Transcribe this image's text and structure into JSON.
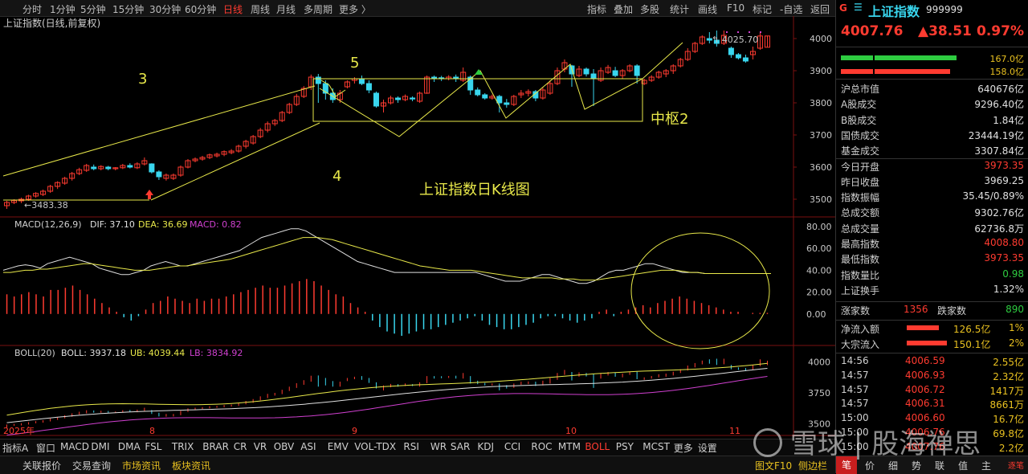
{
  "toolbar": {
    "periods": [
      "分时",
      "1分钟",
      "5分钟",
      "15分钟",
      "30分钟",
      "60分钟",
      "日线",
      "周线",
      "月线",
      "多周期",
      "更多 〉"
    ],
    "active_period": "日线",
    "right_tools": [
      "指标",
      "叠加",
      "多股",
      "统计",
      "画线",
      "F10",
      "标记",
      "-自选",
      "返回"
    ]
  },
  "chart": {
    "title": "上证指数(日线,前复权)",
    "price_ticks": [
      "4000",
      "3900",
      "3800",
      "3700",
      "3600",
      "3500"
    ],
    "high_label": "4025.70",
    "low_label": "3483.38",
    "annotations": {
      "wave3": "3",
      "wave4": "4",
      "wave5": "5",
      "zhongshu": "中枢2",
      "chart_title": "上证指数日K线图"
    },
    "month_labels": [
      "2025年",
      "8",
      "9",
      "10",
      "11"
    ]
  },
  "macd": {
    "label": "MACD(12,26,9)",
    "dif_label": "DIF: 37.10",
    "dea_label": "DEA: 36.69",
    "macd_label": "MACD: 0.82",
    "ticks": [
      "80.00",
      "60.00",
      "40.00",
      "20.00",
      "0.00"
    ]
  },
  "boll": {
    "label": "BOLL(20)",
    "boll_label": "BOLL: 3937.18",
    "ub_label": "UB: 4039.44",
    "lb_label": "LB: 3834.92",
    "ticks": [
      "4000",
      "3750",
      "3500"
    ]
  },
  "indicator_tabs": [
    "指标A",
    "窗口",
    "MACD",
    "DMI",
    "DMA",
    "FSL",
    "TRIX",
    "BRAR",
    "CR",
    "VR",
    "OBV",
    "ASI",
    "EMV",
    "VOL-TDX",
    "RSI",
    "WR",
    "SAR",
    "KDJ",
    "CCI",
    "ROC",
    "MTM",
    "BOLL",
    "PSY",
    "MCST",
    "更多",
    "设置"
  ],
  "active_indicator": "BOLL",
  "status_tabs": [
    "关联报价",
    "交易查询",
    "市场资讯",
    "板块资讯"
  ],
  "status_right": [
    "图文F10",
    "侧边栏"
  ],
  "watermark": "雪球 | 股海禅思",
  "quote": {
    "flag": "G",
    "name": "上证指数",
    "code": "999999",
    "price": "4007.76",
    "change": "▲38.51",
    "pct": "0.97%",
    "bar1": "167.0亿",
    "bar2": "158.0亿",
    "stats": [
      {
        "label": "沪总市值",
        "value": "640676亿",
        "color": "white"
      },
      {
        "label": "A股成交",
        "value": "9296.40亿",
        "color": "white"
      },
      {
        "label": "B股成交",
        "value": "1.84亿",
        "color": "white"
      },
      {
        "label": "国债成交",
        "value": "23444.19亿",
        "color": "white"
      },
      {
        "label": "基金成交",
        "value": "3307.84亿",
        "color": "white"
      },
      {
        "label": "今日开盘",
        "value": "3973.35",
        "color": "red"
      },
      {
        "label": "昨日收盘",
        "value": "3969.25",
        "color": "white"
      },
      {
        "label": "指数振幅",
        "value": "35.45/0.89%",
        "color": "white"
      },
      {
        "label": "总成交额",
        "value": "9302.76亿",
        "color": "white"
      },
      {
        "label": "总成交量",
        "value": "62736.8万",
        "color": "white"
      },
      {
        "label": "最高指数",
        "value": "4008.80",
        "color": "red"
      },
      {
        "label": "最低指数",
        "value": "3973.35",
        "color": "red"
      },
      {
        "label": "指数量比",
        "value": "0.98",
        "color": "green"
      },
      {
        "label": "上证换手",
        "value": "1.32%",
        "color": "white"
      }
    ],
    "up_label": "涨家数",
    "up_value": "1356",
    "down_label": "跌家数",
    "down_value": "890",
    "flow1_label": "净流入额",
    "flow1_value": "126.5亿",
    "flow1_pct": "1%",
    "flow2_label": "大宗流入",
    "flow2_value": "150.1亿",
    "flow2_pct": "2%",
    "ticks": [
      {
        "time": "14:56",
        "price": "4006.59",
        "vol": "2.55亿"
      },
      {
        "time": "14:57",
        "price": "4006.93",
        "vol": "2.32亿"
      },
      {
        "time": "14:57",
        "price": "4006.72",
        "vol": "1417万"
      },
      {
        "time": "14:57",
        "price": "4006.31",
        "vol": "8661万"
      },
      {
        "time": "15:00",
        "price": "4006.60",
        "vol": "16.7亿"
      },
      {
        "time": "15:00",
        "price": "4006.76",
        "vol": "69.8亿"
      },
      {
        "time": "15:00",
        "price": "4007.76",
        "vol": "2.2亿"
      }
    ],
    "bottom_tabs": [
      "笔",
      "价",
      "细",
      "势",
      "联",
      "值",
      "主"
    ],
    "bottom_extra": "逐笔"
  },
  "chart_data": {
    "type": "candlestick",
    "title": "上证指数日K线图",
    "ylim": [
      3450,
      4050
    ],
    "candles": [
      [
        3480,
        3490,
        3470,
        3495
      ],
      [
        3490,
        3496,
        3485,
        3500
      ],
      [
        3495,
        3500,
        3488,
        3505
      ],
      [
        3500,
        3510,
        3495,
        3514
      ],
      [
        3510,
        3518,
        3505,
        3522
      ],
      [
        3515,
        3525,
        3510,
        3530
      ],
      [
        3525,
        3540,
        3520,
        3545
      ],
      [
        3540,
        3552,
        3532,
        3556
      ],
      [
        3550,
        3565,
        3545,
        3570
      ],
      [
        3565,
        3580,
        3558,
        3585
      ],
      [
        3580,
        3592,
        3575,
        3598
      ],
      [
        3590,
        3605,
        3585,
        3610
      ],
      [
        3600,
        3595,
        3590,
        3608
      ],
      [
        3595,
        3602,
        3590,
        3606
      ],
      [
        3600,
        3595,
        3590,
        3604
      ],
      [
        3595,
        3598,
        3590,
        3600
      ],
      [
        3598,
        3605,
        3594,
        3610
      ],
      [
        3605,
        3600,
        3596,
        3612
      ],
      [
        3598,
        3610,
        3594,
        3615
      ],
      [
        3610,
        3620,
        3605,
        3630
      ],
      [
        3610,
        3585,
        3580,
        3612
      ],
      [
        3585,
        3570,
        3560,
        3590
      ],
      [
        3565,
        3575,
        3558,
        3580
      ],
      [
        3565,
        3575,
        3560,
        3580
      ],
      [
        3575,
        3600,
        3570,
        3605
      ],
      [
        3600,
        3620,
        3596,
        3625
      ],
      [
        3620,
        3625,
        3615,
        3630
      ],
      [
        3625,
        3630,
        3620,
        3635
      ],
      [
        3630,
        3638,
        3625,
        3642
      ],
      [
        3635,
        3640,
        3630,
        3645
      ],
      [
        3640,
        3648,
        3634,
        3652
      ],
      [
        3645,
        3650,
        3640,
        3656
      ],
      [
        3650,
        3665,
        3645,
        3670
      ],
      [
        3665,
        3680,
        3658,
        3685
      ],
      [
        3675,
        3695,
        3670,
        3700
      ],
      [
        3695,
        3715,
        3690,
        3722
      ],
      [
        3715,
        3735,
        3708,
        3742
      ],
      [
        3735,
        3745,
        3728,
        3750
      ],
      [
        3745,
        3770,
        3740,
        3775
      ],
      [
        3770,
        3795,
        3765,
        3800
      ],
      [
        3795,
        3820,
        3790,
        3828
      ],
      [
        3820,
        3845,
        3815,
        3852
      ],
      [
        3850,
        3880,
        3840,
        3888
      ],
      [
        3880,
        3860,
        3800,
        3890
      ],
      [
        3860,
        3830,
        3810,
        3870
      ],
      [
        3830,
        3810,
        3800,
        3845
      ],
      [
        3810,
        3830,
        3800,
        3840
      ],
      [
        3850,
        3865,
        3845,
        3870
      ],
      [
        3870,
        3875,
        3860,
        3880
      ],
      [
        3875,
        3860,
        3855,
        3885
      ],
      [
        3860,
        3840,
        3830,
        3870
      ],
      [
        3830,
        3790,
        3785,
        3835
      ],
      [
        3790,
        3800,
        3770,
        3810
      ],
      [
        3800,
        3815,
        3795,
        3822
      ],
      [
        3815,
        3810,
        3800,
        3820
      ],
      [
        3810,
        3820,
        3805,
        3826
      ],
      [
        3815,
        3812,
        3805,
        3820
      ],
      [
        3805,
        3830,
        3800,
        3835
      ],
      [
        3830,
        3880,
        3828,
        3885
      ],
      [
        3880,
        3878,
        3865,
        3885
      ],
      [
        3878,
        3875,
        3868,
        3884
      ],
      [
        3875,
        3880,
        3870,
        3886
      ],
      [
        3880,
        3875,
        3865,
        3888
      ],
      [
        3870,
        3895,
        3865,
        3910
      ],
      [
        3880,
        3840,
        3825,
        3885
      ],
      [
        3840,
        3825,
        3820,
        3848
      ],
      [
        3825,
        3815,
        3810,
        3830
      ],
      [
        3815,
        3820,
        3810,
        3826
      ],
      [
        3820,
        3800,
        3770,
        3825
      ],
      [
        3800,
        3795,
        3785,
        3812
      ],
      [
        3795,
        3820,
        3790,
        3825
      ],
      [
        3825,
        3830,
        3815,
        3840
      ],
      [
        3830,
        3835,
        3820,
        3842
      ],
      [
        3835,
        3815,
        3805,
        3840
      ],
      [
        3815,
        3840,
        3810,
        3848
      ],
      [
        3830,
        3860,
        3825,
        3870
      ],
      [
        3860,
        3900,
        3855,
        3910
      ],
      [
        3905,
        3925,
        3895,
        3935
      ],
      [
        3915,
        3890,
        3850,
        3918
      ],
      [
        3885,
        3905,
        3880,
        3915
      ],
      [
        3905,
        3890,
        3882,
        3910
      ],
      [
        3890,
        3875,
        3790,
        3905
      ],
      [
        3870,
        3900,
        3865,
        3910
      ],
      [
        3895,
        3910,
        3890,
        3918
      ],
      [
        3900,
        3885,
        3880,
        3912
      ],
      [
        3885,
        3900,
        3875,
        3905
      ],
      [
        3900,
        3915,
        3895,
        3920
      ],
      [
        3915,
        3885,
        3860,
        3920
      ],
      [
        3860,
        3870,
        3855,
        3875
      ],
      [
        3870,
        3880,
        3865,
        3886
      ],
      [
        3880,
        3895,
        3875,
        3900
      ],
      [
        3890,
        3900,
        3880,
        3905
      ],
      [
        3900,
        3915,
        3890,
        3920
      ],
      [
        3915,
        3935,
        3910,
        3940
      ],
      [
        3935,
        3960,
        3930,
        3970
      ],
      [
        3960,
        3985,
        3955,
        3990
      ],
      [
        3985,
        4005,
        3980,
        4010
      ],
      [
        4000,
        3995,
        3985,
        4020
      ],
      [
        3995,
        3985,
        3975,
        4025
      ],
      [
        3985,
        4010,
        3980,
        4025
      ],
      [
        3970,
        3950,
        3940,
        3975
      ],
      [
        3950,
        3940,
        3935,
        3955
      ],
      [
        3940,
        3930,
        3925,
        3950
      ],
      [
        3950,
        3960,
        3935,
        3975
      ],
      [
        3970,
        4008,
        3965,
        4020
      ],
      [
        3973,
        4008,
        3973,
        4009
      ]
    ],
    "macd_hist": [
      18,
      16,
      18,
      20,
      18,
      16,
      22,
      22,
      24,
      26,
      22,
      18,
      14,
      10,
      6,
      2,
      -3,
      -6,
      -2,
      4,
      10,
      12,
      16,
      14,
      12,
      10,
      14,
      12,
      14,
      14,
      16,
      18,
      20,
      22,
      24,
      26,
      24,
      24,
      26,
      28,
      30,
      32,
      30,
      26,
      22,
      18,
      16,
      10,
      6,
      2,
      -6,
      -12,
      -16,
      -18,
      -20,
      -18,
      -16,
      -14,
      -14,
      -12,
      -10,
      -8,
      -6,
      -4,
      -2,
      -6,
      -10,
      -12,
      -14,
      -14,
      -12,
      -10,
      -8,
      -4,
      -2,
      -2,
      -4,
      -6,
      -8,
      -6,
      -4,
      2,
      4,
      -2,
      2,
      4,
      6,
      8,
      6,
      10,
      12,
      14,
      16,
      14,
      12,
      10,
      8,
      6,
      4,
      2,
      2,
      0,
      1,
      1,
      1
    ],
    "boll": {
      "mid_start": 3520,
      "mid_end": 3937.18,
      "ub_end": 4039.44,
      "lb_end": 3834.92
    }
  }
}
